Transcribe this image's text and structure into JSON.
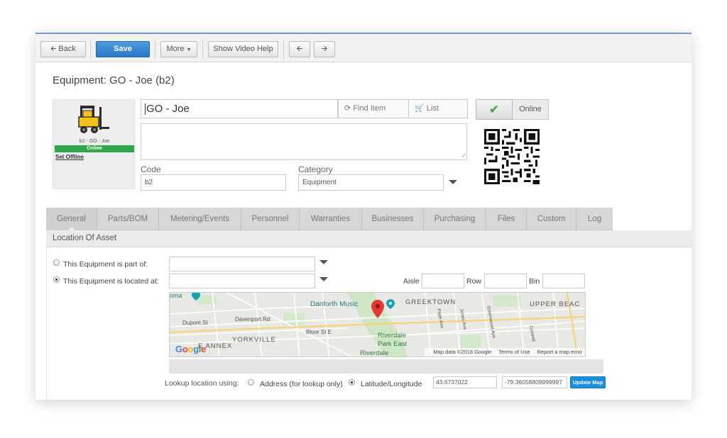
{
  "toolbar": {
    "back_label": "Back",
    "save_label": "Save",
    "more_label": "More",
    "video_help_label": "Show Video Help",
    "prev_icon": "arrow-left-icon",
    "next_icon": "arrow-right-icon"
  },
  "header": {
    "title": "Equipment: GO - Joe (b2)"
  },
  "equipment": {
    "thumb_caption": "b2 - GO - Joe",
    "thumb_status": "Online",
    "set_offline_label": "Set Offline",
    "name_value": "GO - Joe",
    "find_item_label": "Find Item",
    "list_label": "List",
    "description_value": "",
    "status_label": "Online",
    "code_label": "Code",
    "code_value": "b2",
    "category_label": "Category",
    "category_value": "Equipment"
  },
  "tabs": [
    {
      "label": "General",
      "active": true
    },
    {
      "label": "Parts/BOM"
    },
    {
      "label": "Metering/Events"
    },
    {
      "label": "Personnel"
    },
    {
      "label": "Warranties"
    },
    {
      "label": "Businesses"
    },
    {
      "label": "Purchasing"
    },
    {
      "label": "Files"
    },
    {
      "label": "Custom"
    },
    {
      "label": "Log"
    }
  ],
  "location": {
    "section_title": "Location Of Asset",
    "part_of_label": "This Equipment is part of:",
    "part_of_value": "",
    "located_at_label": "This Equipment is located at:",
    "located_at_value": "",
    "aisle_label": "Aisle",
    "row_label": "Row",
    "bin_label": "Bin",
    "lookup_label": "Lookup location using:",
    "address_option": "Address (for lookup only)",
    "latlng_option": "Latitude/Longitude",
    "latitude": "43.6737022",
    "longitude": "-79.36058809999997",
    "update_map_label": "Update Map"
  },
  "map": {
    "labels": {
      "toma": "oma",
      "danforth": "Danforth Music",
      "greektown": "GREEKTOWN",
      "upper_beach": "UPPER BEAC",
      "dupont": "Dupont St",
      "davenport": "Davenport Rd",
      "bloor": "Bloor St E",
      "yorkville": "YORKVILLE",
      "annex": "E ANNEX",
      "riverdale1": "Riverdale",
      "riverdale2": "Park East",
      "riverdale3": "Riverdale",
      "pape": "Pape Ave",
      "jones": "Jones Ave",
      "greenwood": "Greenwood Ave",
      "coxwell": "Coxwell",
      "logo": "Google"
    },
    "attribution": "Map data ©2018 Google",
    "terms": "Terms of Use",
    "report": "Report a map error"
  }
}
